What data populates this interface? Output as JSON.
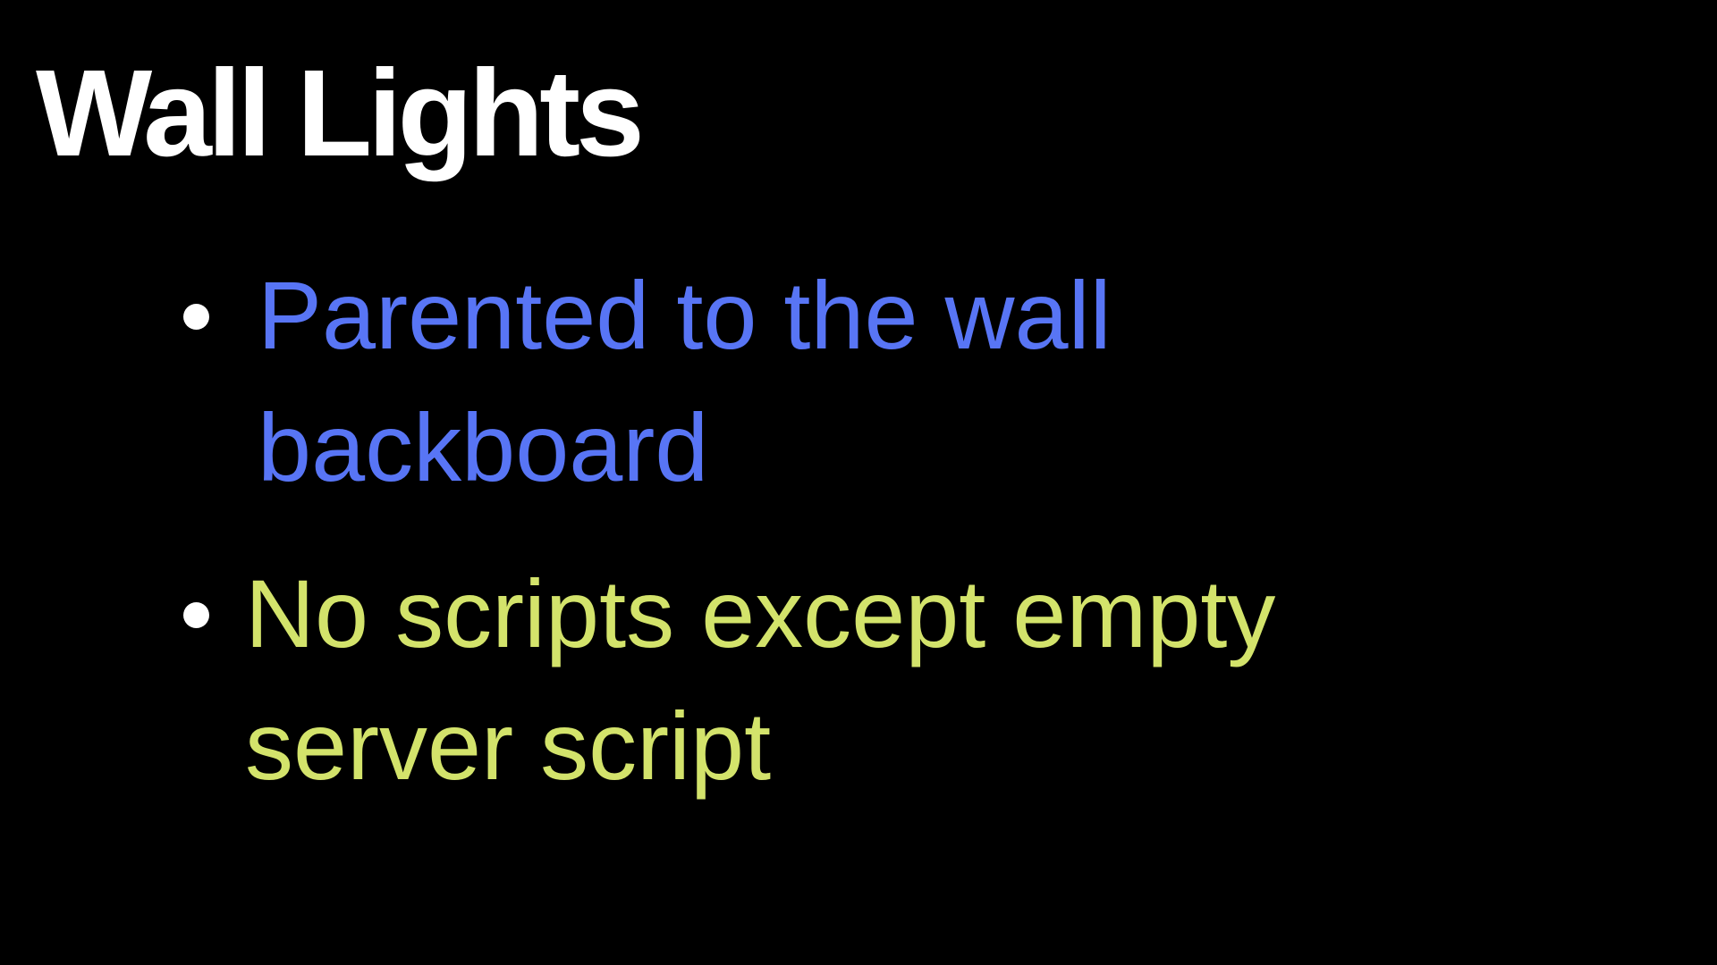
{
  "slide": {
    "title": "Wall Lights",
    "bullets": [
      {
        "text": "Parented to the wall\nbackboard",
        "color": "#5875f5"
      },
      {
        "text": "No scripts except empty\nserver script",
        "color": "#d3e36b"
      }
    ]
  },
  "colors": {
    "background": "#000000",
    "title": "#ffffff",
    "bullet_marker": "#ffffff"
  }
}
